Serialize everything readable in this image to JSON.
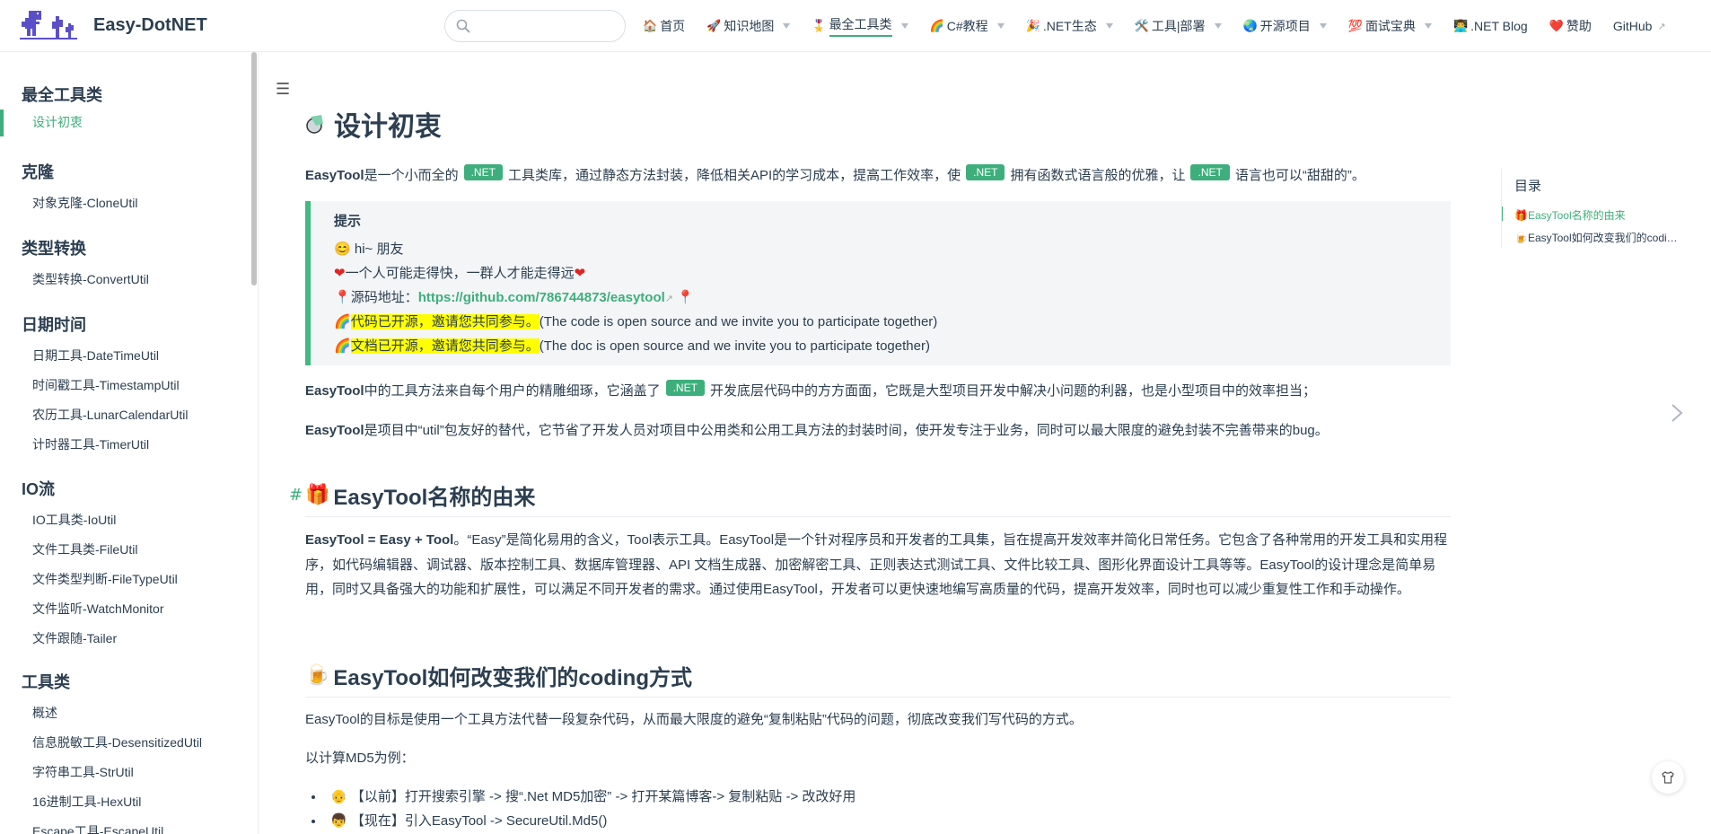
{
  "brand": {
    "name": "Easy-DotNET",
    "logo_icon": "dino-logo-icon"
  },
  "search": {
    "placeholder": "",
    "value": ""
  },
  "nav": [
    {
      "icon": "🏠",
      "label": "首页",
      "dropdown": false,
      "active": false
    },
    {
      "icon": "🚀",
      "label": "知识地图",
      "dropdown": true,
      "active": false
    },
    {
      "icon": "🎖️",
      "label": "最全工具类",
      "dropdown": true,
      "active": true
    },
    {
      "icon": "🌈",
      "label": "C#教程",
      "dropdown": true,
      "active": false
    },
    {
      "icon": "🎉",
      "label": ".NET生态",
      "dropdown": true,
      "active": false
    },
    {
      "icon": "🛠️",
      "label": "工具|部署",
      "dropdown": true,
      "active": false
    },
    {
      "icon": "🌏",
      "label": "开源项目",
      "dropdown": true,
      "active": false
    },
    {
      "icon": "💯",
      "label": "面试宝典",
      "dropdown": true,
      "active": false
    },
    {
      "icon": "👨‍💻",
      "label": ".NET Blog",
      "dropdown": false,
      "active": false
    },
    {
      "icon": "❤️",
      "label": "赞助",
      "dropdown": false,
      "active": false
    },
    {
      "icon": "",
      "label": "GitHub",
      "dropdown": false,
      "active": false,
      "external": true
    }
  ],
  "sidebar": {
    "groups": [
      {
        "heading": "最全工具类",
        "items": [
          "设计初衷"
        ],
        "active_item": 0
      },
      {
        "heading": "克隆",
        "items": [
          "对象克隆-CloneUtil"
        ]
      },
      {
        "heading": "类型转换",
        "items": [
          "类型转换-ConvertUtil"
        ]
      },
      {
        "heading": "日期时间",
        "items": [
          "日期工具-DateTimeUtil",
          "时间戳工具-TimestampUtil",
          "农历工具-LunarCalendarUtil",
          "计时器工具-TimerUtil"
        ]
      },
      {
        "heading": "IO流",
        "items": [
          "IO工具类-IoUtil",
          "文件工具类-FileUtil",
          "文件类型判断-FileTypeUtil",
          "文件监听-WatchMonitor",
          "文件跟随-Tailer"
        ]
      },
      {
        "heading": "工具类",
        "items": [
          "概述",
          "信息脱敏工具-DesensitizedUtil",
          "字符串工具-StrUtil",
          "16进制工具-HexUtil",
          "Escape工具-EscapeUtil"
        ]
      }
    ]
  },
  "page": {
    "title": "设计初衷",
    "intro": {
      "b": "EasyTool",
      "t1": "是一个小而全的",
      "badge": ".NET",
      "t2": "工具类库，通过静态方法封装，降低相关API的学习成本，提高工作效率，使",
      "t3": "拥有函数式语言般的优雅，让",
      "t4": "语言也可以“甜甜的”。"
    },
    "tip": {
      "title": "提示",
      "line1": "hi~ 朋友",
      "line2": "一个人可能走得快，一群人才能走得远",
      "line3_label": "源码地址：",
      "line3_link": "https://github.com/786744873/easytool",
      "line4_hl": "代码已开源，邀请您共同参与。",
      "line4_rest": "(The code is open source and we invite you to participate together)",
      "line5_hl": "文档已开源，邀请您共同参与。",
      "line5_rest": "(The doc is open source and we invite you to participate together)"
    },
    "para2": {
      "b": "EasyTool",
      "t1": "中的工具方法来自每个用户的精雕细琢，它涵盖了",
      "badge": ".NET",
      "t2": "开发底层代码中的方方面面，它既是大型项目开发中解决小问题的利器，也是小型项目中的效率担当；"
    },
    "para3": {
      "b": "EasyTool",
      "t1": "是项目中“util”包友好的替代，它节省了开发人员对项目中公用类和公用工具方法的封装时间，使开发专注于业务，同时可以最大限度的避免封装不完善带来的bug。"
    },
    "section1": {
      "anchor": "#",
      "icon": "🎁",
      "title": "EasyTool名称的由来",
      "b": "EasyTool = Easy + Tool",
      "text": "。“Easy”是简化易用的含义，Tool表示工具。EasyTool是一个针对程序员和开发者的工具集，旨在提高开发效率并简化日常任务。它包含了各种常用的开发工具和实用程序，如代码编辑器、调试器、版本控制工具、数据库管理器、API 文档生成器、加密解密工具、正则表达式测试工具、文件比较工具、图形化界面设计工具等等。EasyTool的设计理念是简单易用，同时又具备强大的功能和扩展性，可以满足不同开发者的需求。通过使用EasyTool，开发者可以更快速地编写高质量的代码，提高开发效率，同时也可以减少重复性工作和手动操作。"
    },
    "section2": {
      "icon": "🍺",
      "title": "EasyTool如何改变我们的coding方式",
      "text1": "EasyTool的目标是使用一个工具方法代替一段复杂代码，从而最大限度的避免“复制粘贴”代码的问题，彻底改变我们写代码的方式。",
      "text2": "以计算MD5为例：",
      "bullets": [
        {
          "icon": "👴",
          "text": "【以前】打开搜索引擎 -> 搜“.Net MD5加密” -> 打开某篇博客-> 复制粘贴 -> 改改好用"
        },
        {
          "icon": "👦",
          "text": "【现在】引入EasyTool -> SecureUtil.Md5()"
        }
      ]
    }
  },
  "toc": {
    "title": "目录",
    "items": [
      {
        "icon": "🎁",
        "label": "EasyTool名称的由来",
        "active": true
      },
      {
        "icon": "🍺",
        "label": "EasyTool如何改变我们的coding方式",
        "active": false
      }
    ]
  },
  "colors": {
    "accent": "#3eaf7c",
    "text": "#2c3e50",
    "tip_bg": "#f3f5f7",
    "highlight": "#ffff00"
  }
}
